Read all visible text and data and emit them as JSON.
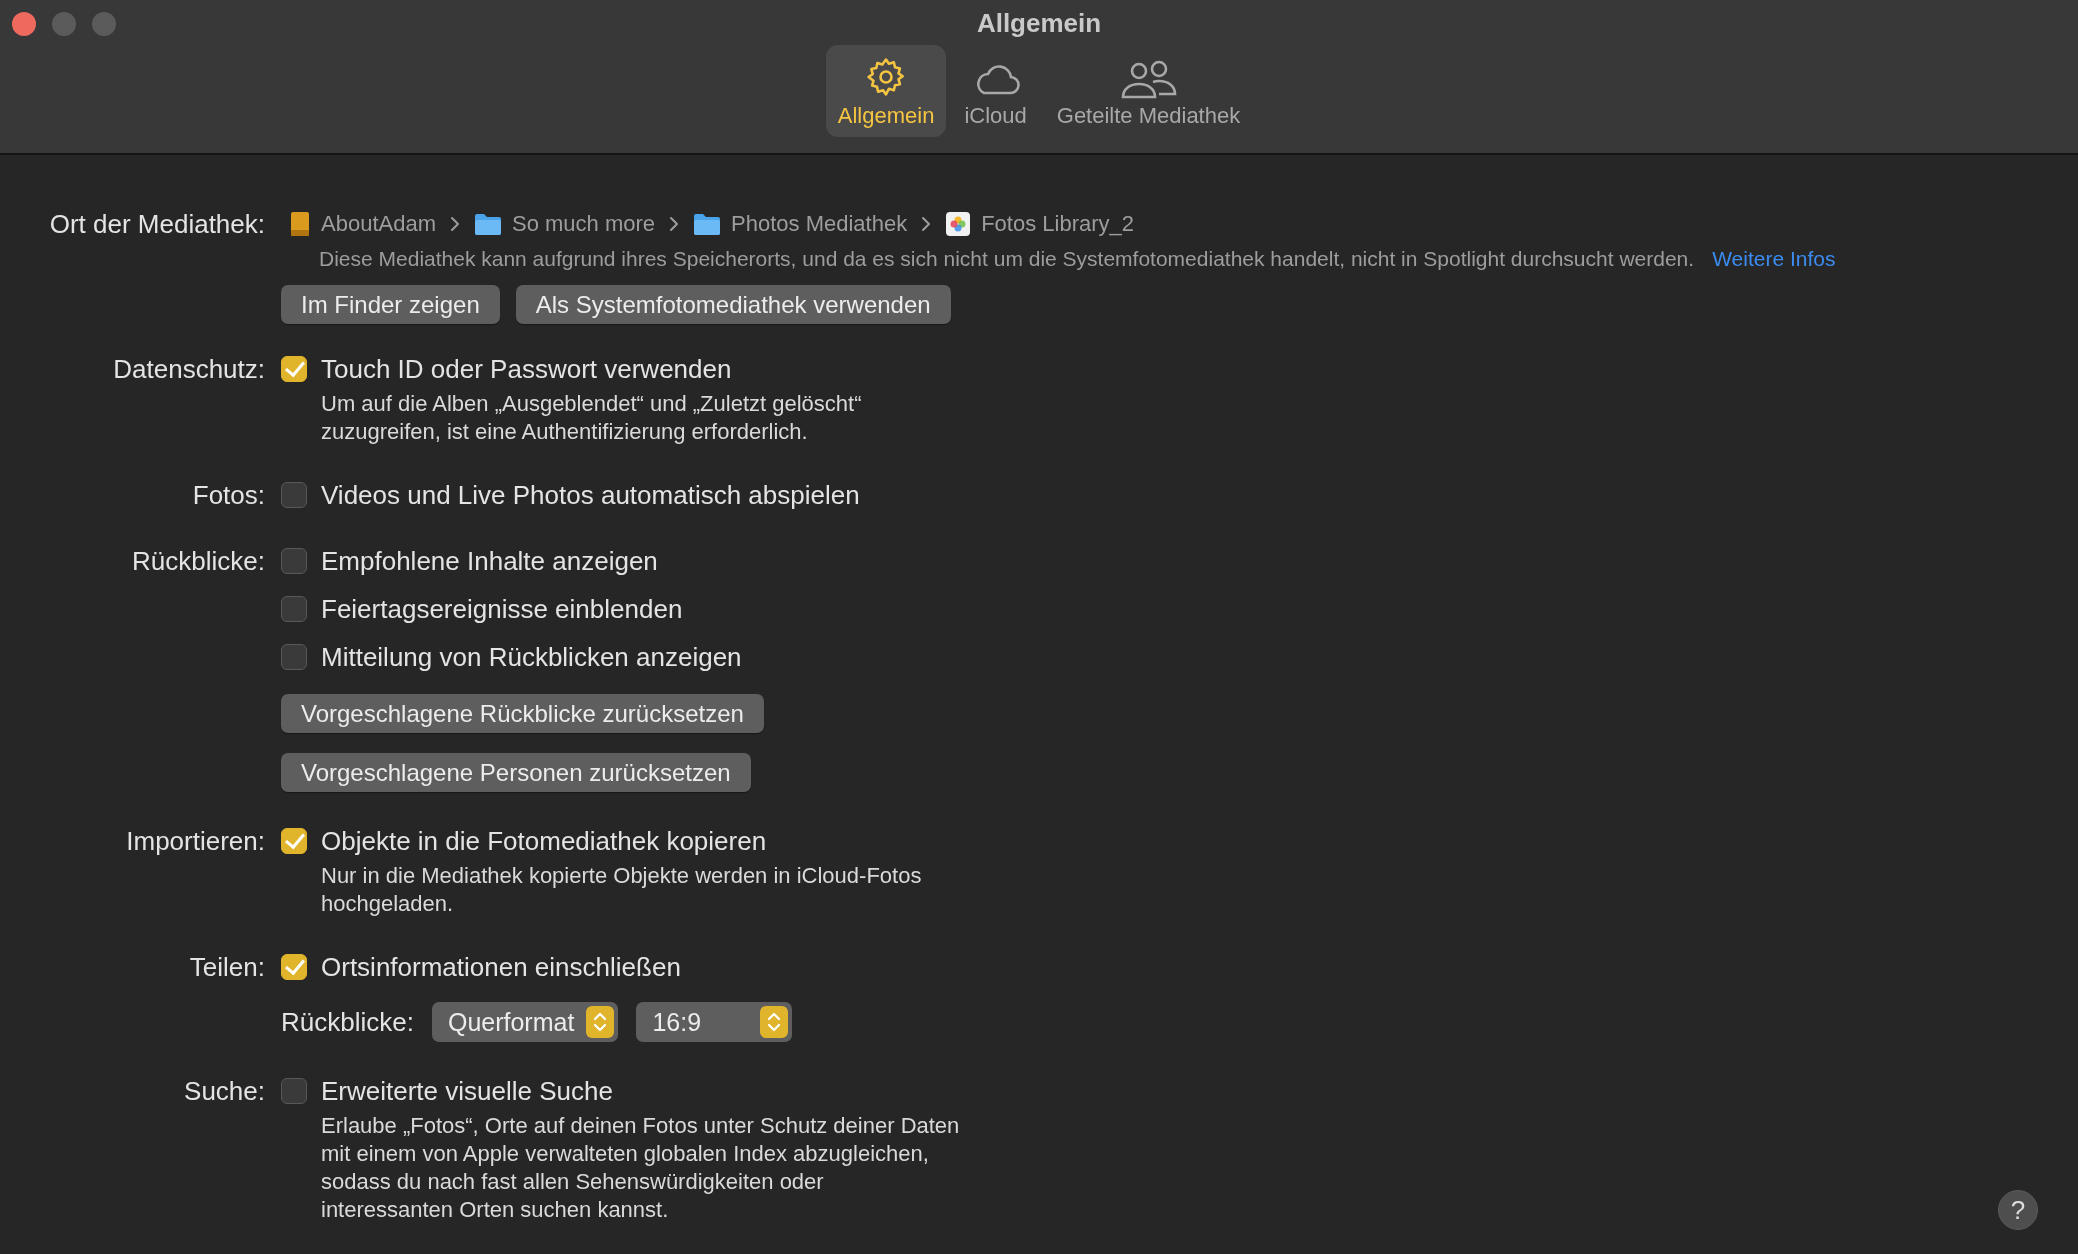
{
  "window": {
    "title": "Allgemein"
  },
  "tabs": [
    {
      "label": "Allgemein",
      "kind": "gear",
      "selected": true
    },
    {
      "label": "iCloud",
      "kind": "cloud",
      "selected": false
    },
    {
      "label": "Geteilte Mediathek",
      "kind": "people",
      "selected": false
    }
  ],
  "library": {
    "label": "Ort der Mediathek:",
    "path": [
      {
        "kind": "drive",
        "name": "AboutAdam"
      },
      {
        "kind": "folder",
        "name": "So much more"
      },
      {
        "kind": "folder",
        "name": "Photos Mediathek"
      },
      {
        "kind": "photos",
        "name": "Fotos Library_2"
      }
    ],
    "note": "Diese Mediathek kann aufgrund ihres Speicherorts, und da es sich nicht um die Systemfotomediathek handelt, nicht in Spotlight durchsucht werden.",
    "link": "Weitere Infos",
    "buttons": [
      "Im Finder zeigen",
      "Als Systemfotomediathek verwenden"
    ]
  },
  "sections": [
    {
      "label": "Datenschutz:",
      "items": [
        {
          "kind": "checkbox",
          "label": "Touch ID oder Passwort verwenden",
          "checked": true,
          "description": "Um auf die Alben „Ausgeblendet“ und „Zuletzt gelöscht“ zuzugreifen, ist eine Authentifizierung erforderlich."
        }
      ]
    },
    {
      "label": "Fotos:",
      "items": [
        {
          "kind": "checkbox",
          "label": "Videos und Live Photos automatisch abspielen",
          "checked": false
        }
      ]
    },
    {
      "label": "Rückblicke:",
      "items": [
        {
          "kind": "checkbox",
          "label": "Empfohlene Inhalte anzeigen",
          "checked": false
        },
        {
          "kind": "checkbox",
          "label": "Feiertagsereignisse einblenden",
          "checked": false
        },
        {
          "kind": "checkbox",
          "label": "Mitteilung von Rückblicken anzeigen",
          "checked": false
        },
        {
          "kind": "button",
          "label": "Vorgeschlagene Rückblicke zurücksetzen"
        },
        {
          "kind": "button",
          "label": "Vorgeschlagene Personen zurücksetzen"
        }
      ]
    },
    {
      "label": "Importieren:",
      "items": [
        {
          "kind": "checkbox",
          "label": "Objekte in die Fotomediathek kopieren",
          "checked": true,
          "description": "Nur in die Mediathek kopierte Objekte werden in iCloud-Fotos hochgeladen."
        }
      ]
    },
    {
      "label": "Teilen:",
      "items": [
        {
          "kind": "checkbox",
          "label": "Ortsinformationen einschließen",
          "checked": true
        },
        {
          "kind": "popups",
          "label": "Rückblicke:",
          "popups": [
            {
              "value": "Querformat"
            },
            {
              "value": "16:9"
            }
          ]
        }
      ]
    },
    {
      "label": "Suche:",
      "items": [
        {
          "kind": "checkbox",
          "label": "Erweiterte visuelle Suche",
          "checked": false,
          "description": "Erlaube „Fotos“, Orte auf deinen Fotos unter Schutz deiner Daten mit einem von Apple verwalteten globalen Index abzugleichen, sodass du nach fast allen Sehenswürdigkeiten oder interessanten Orten suchen kannst."
        }
      ]
    }
  ],
  "help": "?"
}
